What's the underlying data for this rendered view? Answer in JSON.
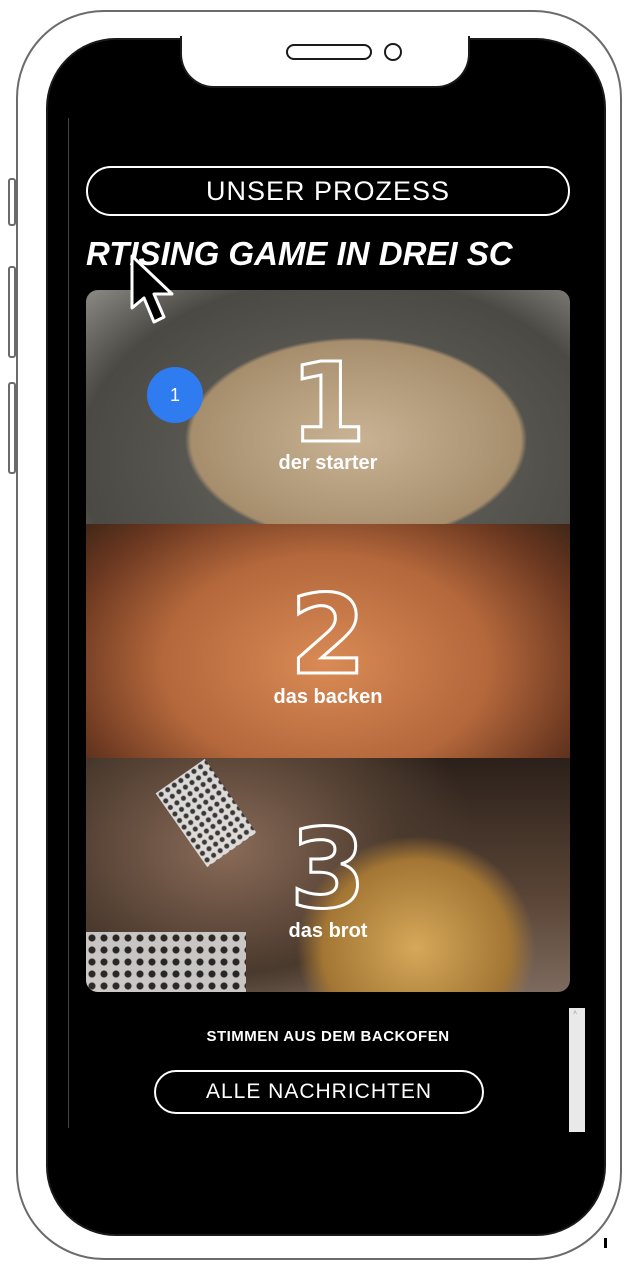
{
  "header": {
    "section_button": "UNSER PROZESS",
    "marquee_text": "RTISING GAME IN DREI SC"
  },
  "steps": [
    {
      "number": "1",
      "label": "der starter"
    },
    {
      "number": "2",
      "label": "das backen"
    },
    {
      "number": "3",
      "label": "das brot"
    }
  ],
  "badge": {
    "count": "1",
    "color": "#2f7bf0"
  },
  "voices": {
    "heading": "STIMMEN AUS DEM BACKOFEN",
    "all_messages_button": "ALLE NACHRICHTEN"
  },
  "scrollbar": {
    "arrow": "˄"
  },
  "colors": {
    "background": "#000000",
    "text": "#ffffff",
    "frame": "#6b6b6b"
  }
}
